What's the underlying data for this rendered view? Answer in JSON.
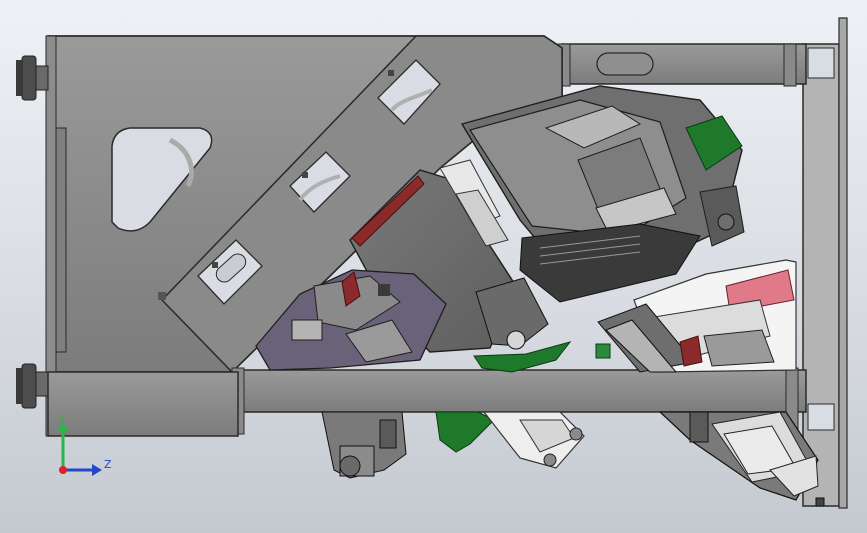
{
  "triad": {
    "y_label": "Y",
    "z_label": "Z",
    "x_color": "#d8222a",
    "y_color": "#2cb34a",
    "z_color": "#2447c8"
  },
  "colors": {
    "background_top": "#eef1f5",
    "background_bottom": "#c4c9d0",
    "frame_steel": "#8d8d8d",
    "frame_edge": "#2a2a2a",
    "bracket_green": "#1e7a2a",
    "accent_red": "#8a2a2a",
    "white_part": "#f2f2f2",
    "purple_part": "#6a6278"
  }
}
